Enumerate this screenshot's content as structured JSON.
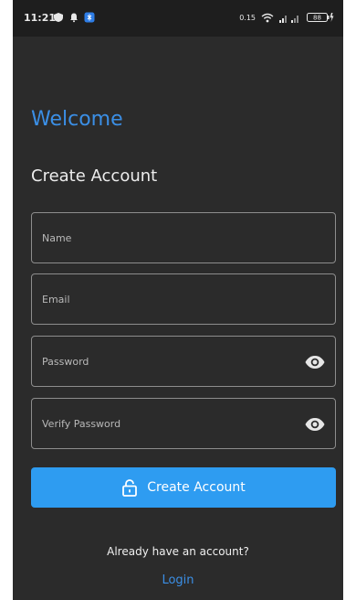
{
  "status_bar": {
    "time": "11:21",
    "network_speed": "0.15",
    "battery": "88"
  },
  "screen": {
    "welcome": "Welcome",
    "subtitle": "Create Account"
  },
  "form": {
    "name_placeholder": "Name",
    "email_placeholder": "Email",
    "password_placeholder": "Password",
    "verify_placeholder": "Verify Password",
    "submit_label": "Create Account"
  },
  "footer": {
    "question": "Already have an account?",
    "login_label": "Login"
  },
  "colors": {
    "background": "#2b2b2b",
    "accent": "#3b8fe6",
    "button": "#2e9cf1"
  },
  "icons": [
    "shield-icon",
    "notification-icon",
    "app-icon",
    "wifi-icon",
    "signal-icon",
    "battery-icon",
    "eye-icon",
    "lock-icon"
  ]
}
